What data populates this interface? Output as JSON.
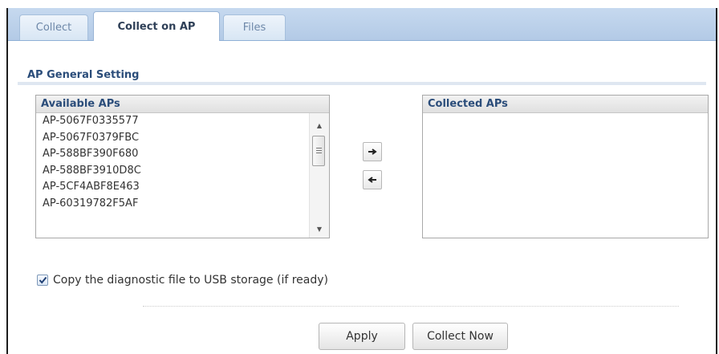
{
  "tabs": [
    {
      "label": "Collect",
      "active": false
    },
    {
      "label": "Collect on AP",
      "active": true
    },
    {
      "label": "Files",
      "active": false
    }
  ],
  "section": {
    "title": "AP General Setting"
  },
  "available_aps": {
    "header": "Available APs",
    "items": [
      "AP-5067F0335577",
      "AP-5067F0379FBC",
      "AP-588BF390F680",
      "AP-588BF3910D8C",
      "AP-5CF4ABF8E463",
      "AP-60319782F5AF"
    ]
  },
  "collected_aps": {
    "header": "Collected APs",
    "items": []
  },
  "usb_option": {
    "label": "Copy the diagnostic file to USB storage (if ready)",
    "checked": true
  },
  "buttons": {
    "apply": "Apply",
    "collect_now": "Collect Now"
  },
  "colors": {
    "tab_bar": "#c6d9ef",
    "heading_blue": "#2b4d7a",
    "section_rule": "#dfe7f1"
  }
}
